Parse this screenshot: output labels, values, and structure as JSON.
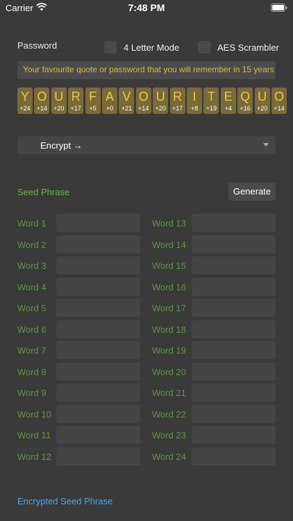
{
  "status": {
    "carrier": "Carrier",
    "time": "7:48 PM"
  },
  "password": {
    "label": "Password",
    "four_letter_mode": "4 Letter Mode",
    "aes_scrambler": "AES Scrambler",
    "value": "Your favourite quote or password that you will remember in 15 years",
    "tiles": [
      {
        "letter": "Y",
        "num": "+24"
      },
      {
        "letter": "O",
        "num": "+14"
      },
      {
        "letter": "U",
        "num": "+20"
      },
      {
        "letter": "R",
        "num": "+17"
      },
      {
        "letter": "F",
        "num": "+5"
      },
      {
        "letter": "A",
        "num": "+0"
      },
      {
        "letter": "V",
        "num": "+21"
      },
      {
        "letter": "O",
        "num": "+14"
      },
      {
        "letter": "U",
        "num": "+20"
      },
      {
        "letter": "R",
        "num": "+17"
      },
      {
        "letter": "I",
        "num": "+8"
      },
      {
        "letter": "T",
        "num": "+19"
      },
      {
        "letter": "E",
        "num": "+4"
      },
      {
        "letter": "Q",
        "num": "+16"
      },
      {
        "letter": "U",
        "num": "+20"
      },
      {
        "letter": "O",
        "num": "+14"
      }
    ]
  },
  "action": {
    "encrypt_label": "Encrypt →"
  },
  "seed": {
    "title": "Seed Phrase",
    "generate_label": "Generate",
    "words": [
      "Word 1",
      "Word 2",
      "Word 3",
      "Word 4",
      "Word 5",
      "Word 6",
      "Word 7",
      "Word 8",
      "Word 9",
      "Word 10",
      "Word 11",
      "Word 12",
      "Word 13",
      "Word 14",
      "Word 15",
      "Word 16",
      "Word 17",
      "Word 18",
      "Word 19",
      "Word 20",
      "Word 21",
      "Word 22",
      "Word 23",
      "Word 24"
    ]
  },
  "encrypted": {
    "title": "Encrypted Seed Phrase"
  }
}
